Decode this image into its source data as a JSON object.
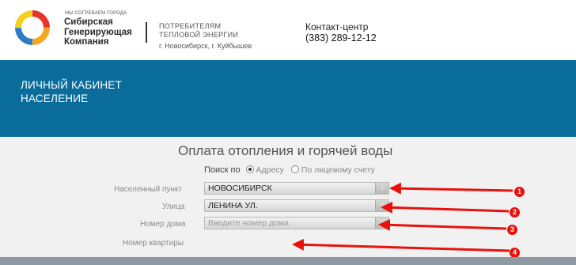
{
  "header": {
    "logo_tagline": "МЫ СОГРЕВАЕМ ГОРОДА",
    "logo_name": "Сибирская\nГенерирующая\nКомпания",
    "consumer_text": "ПОТРЕБИТЕЛЯМ\nТЕПЛОВОЙ ЭНЕРГИИ",
    "city_text": "г. Новосибирск, г. Куйбышев",
    "contact_label": "Контакт-центр",
    "contact_phone": "(383) 289-12-12"
  },
  "band": {
    "title": "ЛИЧНЫЙ КАБИНЕТ\nНАСЕЛЕНИЕ"
  },
  "form": {
    "title": "Оплата отопления и горячей воды",
    "search_label": "Поиск по",
    "search_options": [
      {
        "label": "Адресу",
        "checked": true
      },
      {
        "label": "По лицевому счету",
        "checked": false
      }
    ],
    "fields": [
      {
        "label": "Населенный пункт",
        "value": "НОВОСИБИРСК",
        "type": "select"
      },
      {
        "label": "Улица",
        "value": "ЛЕНИНА УЛ.",
        "type": "select"
      },
      {
        "label": "Номер дома",
        "value": "Введите номер дома",
        "type": "select-placeholder"
      },
      {
        "label": "Номер квартиры",
        "value": "",
        "type": "empty"
      }
    ],
    "arrow_glyph": "↓"
  },
  "annotations": {
    "color": "#e8120c",
    "markers": [
      "1",
      "2",
      "3",
      "4"
    ]
  }
}
